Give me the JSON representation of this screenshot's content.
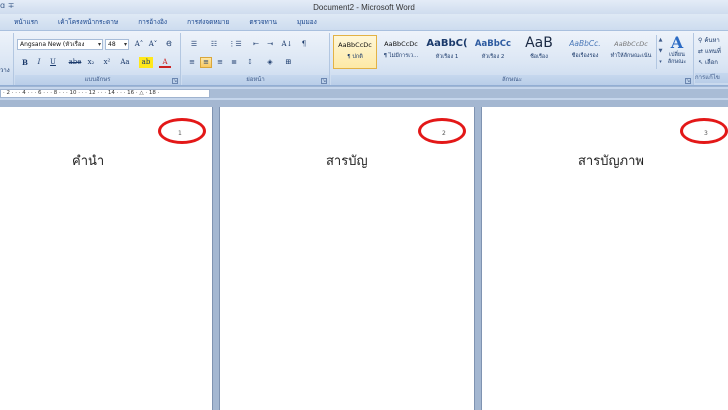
{
  "titlebar": {
    "quick_access": "ɑ ∓",
    "title": "Document2 - Microsoft Word"
  },
  "tabs": [
    "หน้าแรก",
    "เค้าโครงหน้ากระดาษ",
    "การอ้างอิง",
    "การส่งจดหมาย",
    "ตรวจทาน",
    "มุมมอง"
  ],
  "clipboard": {
    "paste_label": "วาง"
  },
  "font": {
    "name": "Angsana New (หัวเรื่อง",
    "size": "48",
    "grow_label": "A˄",
    "shrink_label": "A˅",
    "clear_label": "Ꞡ",
    "bold": "B",
    "italic": "I",
    "underline": "U",
    "strike": "abe",
    "subscript": "x₂",
    "superscript": "x²",
    "case": "Aa",
    "highlight": "ab",
    "font_color": "A",
    "group_label": "แบบอักษร"
  },
  "paragraph": {
    "bullets": "☰",
    "numbering": "☷",
    "multilevel": "⋮☰",
    "decrease_indent": "⇤",
    "increase_indent": "⇥",
    "sort": "A↓",
    "show_marks": "¶",
    "group_label": "ย่อหน้า"
  },
  "styles": {
    "items": [
      {
        "sample": "AaBbCcDc",
        "name": "¶ ปกติ",
        "size": "6.5px",
        "selected": true
      },
      {
        "sample": "AaBbCcDc",
        "name": "¶ ไม่มีการเว...",
        "size": "6.5px",
        "selected": false
      },
      {
        "sample": "AaBbC(",
        "name": "หัวเรื่อง 1",
        "size": "10px",
        "selected": false
      },
      {
        "sample": "AaBbCc",
        "name": "หัวเรื่อง 2",
        "size": "9px",
        "selected": false
      },
      {
        "sample": "AaB",
        "name": "ชื่อเรื่อง",
        "size": "14px",
        "selected": false
      },
      {
        "sample": "AaBbCc.",
        "name": "ชื่อเรื่องรอง",
        "size": "8px",
        "selected": false
      },
      {
        "sample": "AaBbCcDc",
        "name": "ทำให้ลักษณะเน้น",
        "size": "6.5px",
        "selected": false
      }
    ],
    "group_label": "ลักษณะ",
    "change_styles_label": "เปลี่ยน ลักษณะ"
  },
  "editing": {
    "find": "ค้นหา",
    "replace": "แทนที่",
    "select": "เลือก",
    "group_label": "การแก้ไข"
  },
  "ruler": {
    "text": "· 2 · · · 4 · · · 6 · · · 8 · · · 10 · · · 12 · · · 14 · · · 16 · △ · 18 ·"
  },
  "pages": [
    {
      "number": "1",
      "heading": "คำนำ"
    },
    {
      "number": "2",
      "heading": "สารบัญ"
    },
    {
      "number": "3",
      "heading": "สารบัญภาพ"
    }
  ]
}
